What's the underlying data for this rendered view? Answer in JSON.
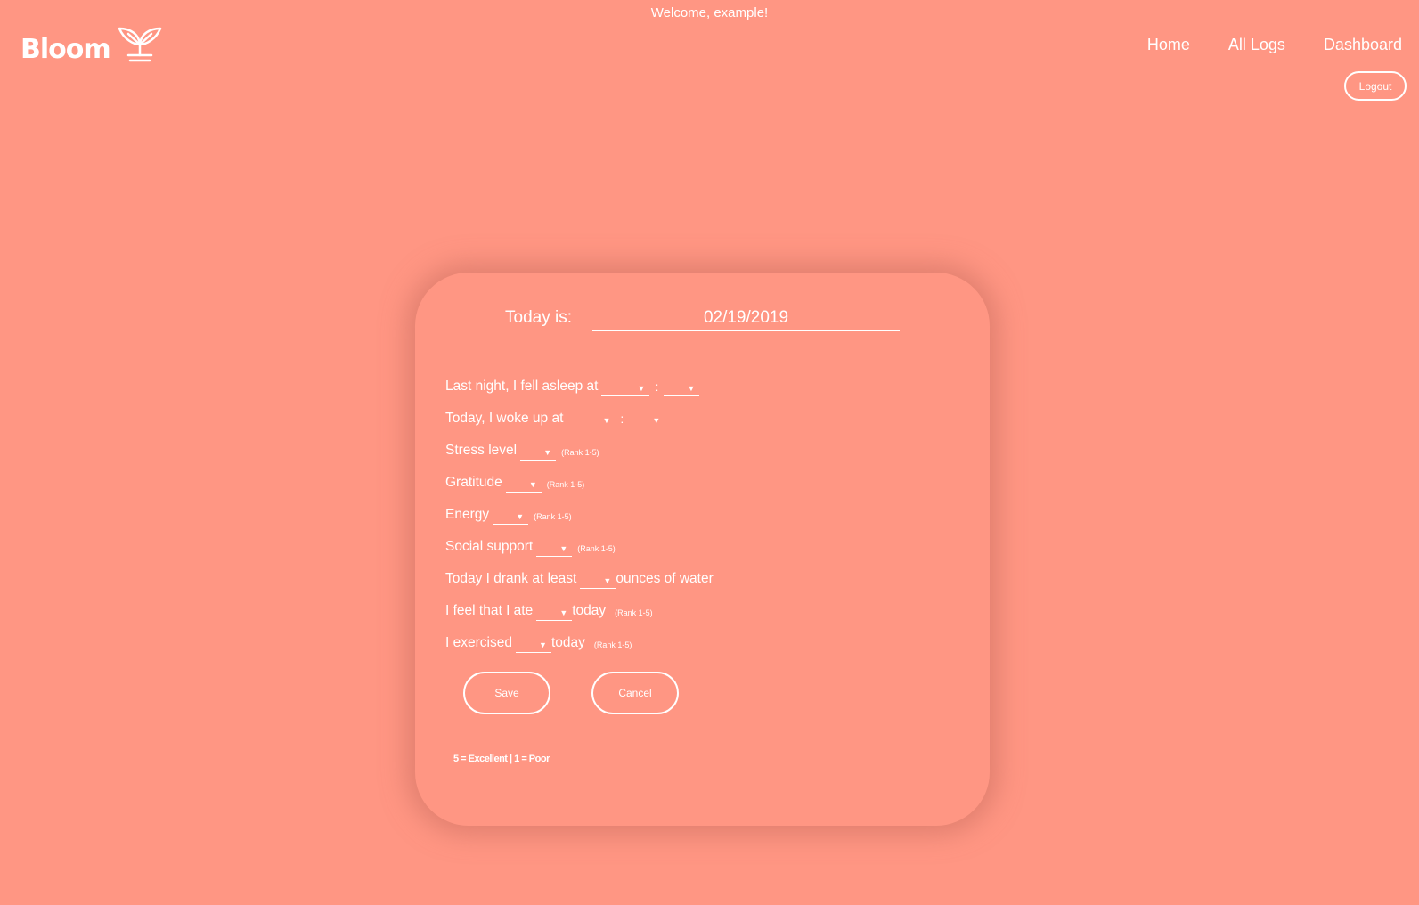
{
  "header": {
    "welcome": "Welcome, example!",
    "brand": "Bloom",
    "logo_icon": "sprout-icon",
    "nav": [
      "Home",
      "All Logs",
      "Dashboard"
    ],
    "logout_label": "Logout"
  },
  "colors": {
    "background": "#ff9683",
    "foreground": "#ffffff"
  },
  "form": {
    "date_label": "Today is:",
    "date_value": "02/19/2019",
    "rows": {
      "sleep": {
        "label": "Last night, I fell asleep at",
        "separator": ":"
      },
      "wake": {
        "label": "Today, I woke up at",
        "separator": ":"
      },
      "stress": {
        "label": "Stress level",
        "hint": "(Rank 1-5)"
      },
      "gratitude": {
        "label": "Gratitude",
        "hint": "(Rank 1-5)"
      },
      "energy": {
        "label": "Energy",
        "hint": "(Rank 1-5)"
      },
      "social": {
        "label": "Social support",
        "hint": "(Rank 1-5)"
      },
      "water": {
        "label": "Today I drank at least",
        "suffix": "ounces of water"
      },
      "ate": {
        "label": "I feel that I ate",
        "suffix": "today",
        "hint": "(Rank 1-5)"
      },
      "exercise": {
        "label": "I exercised",
        "suffix": "today",
        "hint": "(Rank 1-5)"
      }
    },
    "dropdown_icon": "caret-down-icon",
    "save_label": "Save",
    "cancel_label": "Cancel",
    "legend": "5 = Excellent | 1 = Poor"
  }
}
